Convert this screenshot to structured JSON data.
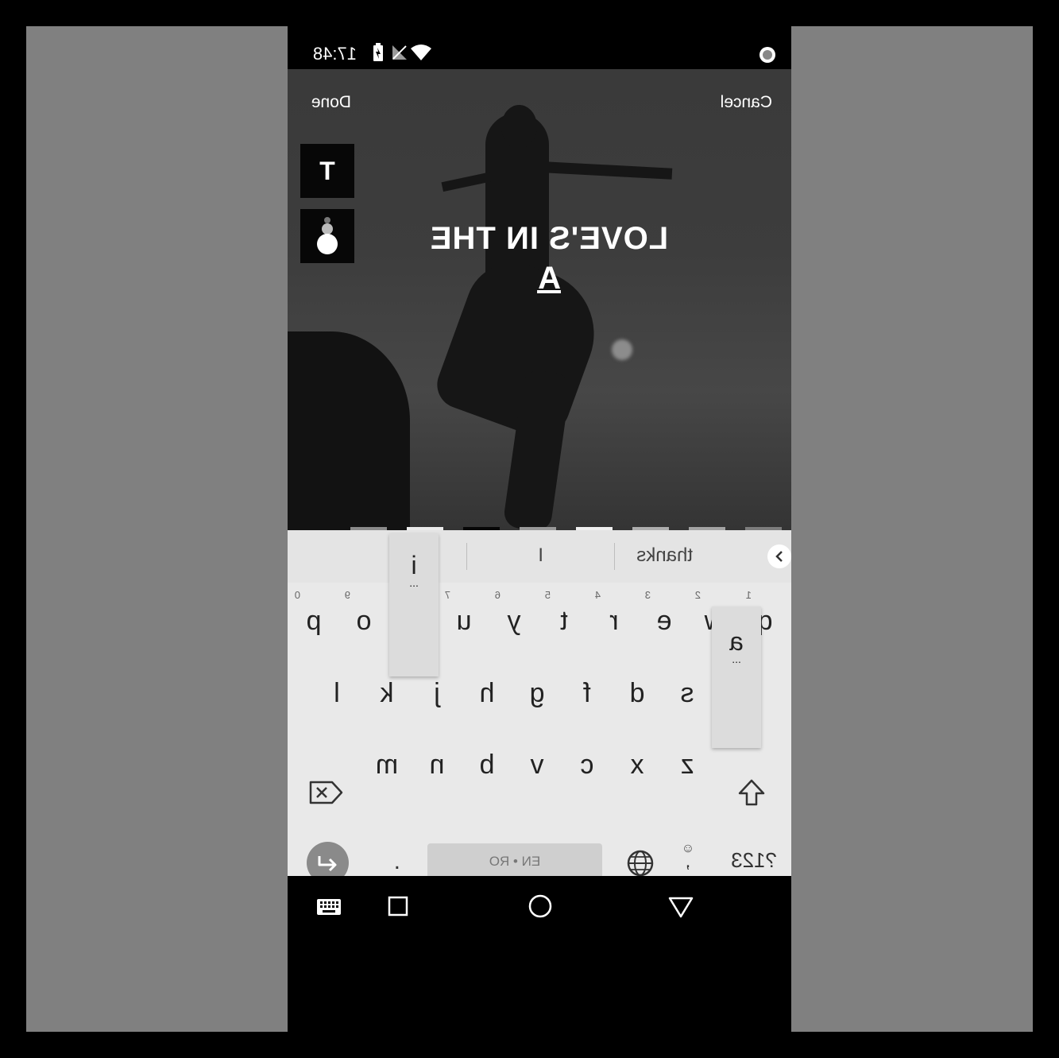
{
  "status_bar": {
    "time": "17:48",
    "icons": [
      "battery-charging-icon",
      "signal-off-icon",
      "wifi-icon",
      "record-indicator-icon"
    ]
  },
  "editor": {
    "cancel_label": "Cancel",
    "done_label": "Done",
    "tools": [
      "text-style-icon",
      "text-color-icon"
    ],
    "overlay_text_line1": "LOVE'S IN THE",
    "overlay_text_line2": "A",
    "color_swatches": [
      "#7d7d7d",
      "#a3a3a3",
      "#adadad",
      "#f0f0f0",
      "#999999",
      "#060606",
      "#ececec",
      "#8a8a8a"
    ]
  },
  "keyboard": {
    "suggestions": [
      "thanks",
      "I",
      "i"
    ],
    "expand_icon": "chevron-right-icon",
    "row1": [
      "q",
      "w",
      "e",
      "r",
      "t",
      "y",
      "u",
      "i",
      "o",
      "p"
    ],
    "row1_hints": [
      "1",
      "2",
      "3",
      "4",
      "5",
      "6",
      "7",
      "8",
      "9",
      "0"
    ],
    "row2": [
      "a",
      "s",
      "d",
      "f",
      "g",
      "h",
      "j",
      "k",
      "l"
    ],
    "row3": [
      "z",
      "x",
      "c",
      "v",
      "b",
      "n",
      "m"
    ],
    "symbols_label": "?123",
    "comma_label": ",",
    "space_label": "EN • RO",
    "period_label": ".",
    "popup_a": "a",
    "popup_i": "i",
    "popup_dots": "..."
  },
  "nav_bar": {
    "icons": [
      "back-icon",
      "home-icon",
      "recents-icon",
      "keyboard-icon"
    ]
  }
}
